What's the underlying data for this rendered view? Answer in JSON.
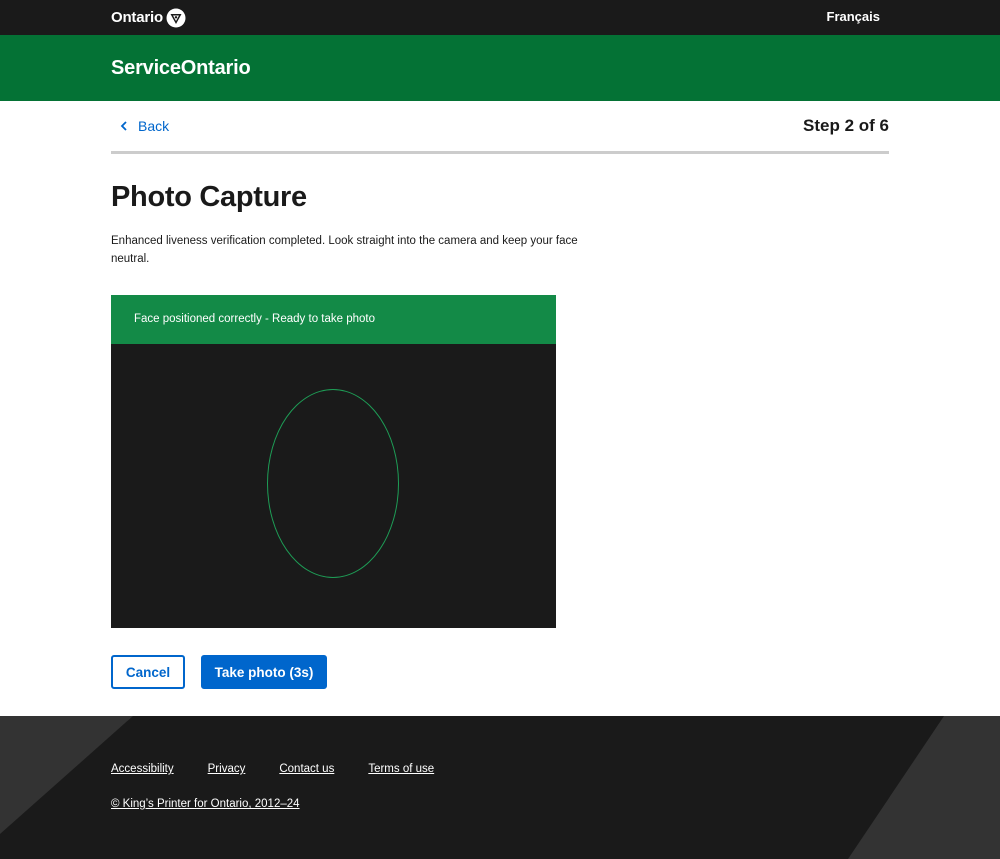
{
  "header": {
    "logo_text": "Ontario",
    "language_link": "Français"
  },
  "brand": {
    "service_title": "ServiceOntario"
  },
  "step_nav": {
    "back_label": "Back",
    "step_indicator": "Step 2 of 6"
  },
  "main": {
    "title": "Photo Capture",
    "instructions": "Enhanced liveness verification completed. Look straight into the camera and keep your face neutral.",
    "camera": {
      "status_message": "Face positioned correctly - Ready to take photo"
    },
    "actions": {
      "cancel_label": "Cancel",
      "take_photo_label": "Take photo (3s)"
    }
  },
  "footer": {
    "links": [
      "Accessibility",
      "Privacy",
      "Contact us",
      "Terms of use"
    ],
    "copyright": "© King’s Printer for Ontario, 2012–24"
  },
  "colors": {
    "top_bar": "#1a1a1a",
    "brand_green": "#047235",
    "status_green": "#138a47",
    "link_blue": "#0066cc",
    "face_guide": "#1e9d56"
  },
  "icons": {
    "logo": "ontario-trillium-icon",
    "back": "chevron-left-icon"
  }
}
